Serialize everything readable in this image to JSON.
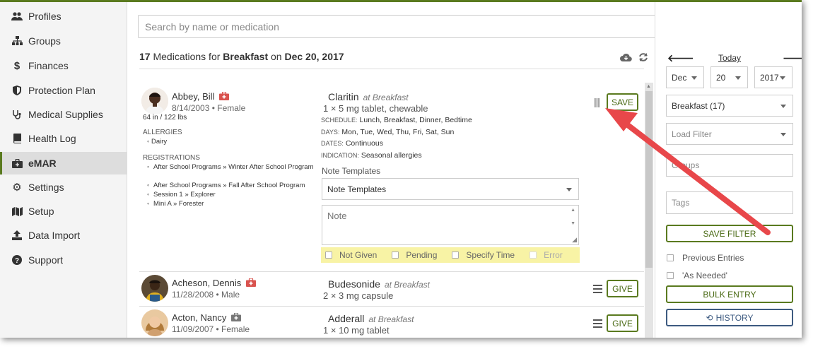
{
  "sidebar": {
    "items": [
      {
        "label": "Profiles",
        "icon": "users-icon"
      },
      {
        "label": "Groups",
        "icon": "sitemap-icon"
      },
      {
        "label": "Finances",
        "icon": "dollar-icon"
      },
      {
        "label": "Protection Plan",
        "icon": "shield-icon"
      },
      {
        "label": "Medical Supplies",
        "icon": "stethoscope-icon"
      },
      {
        "label": "Health Log",
        "icon": "book-icon"
      },
      {
        "label": "eMAR",
        "icon": "medkit-icon",
        "active": true
      },
      {
        "label": "Settings",
        "icon": "gear-icon"
      },
      {
        "label": "Setup",
        "icon": "map-icon"
      },
      {
        "label": "Data Import",
        "icon": "upload-icon"
      },
      {
        "label": "Support",
        "icon": "question-icon"
      }
    ]
  },
  "search": {
    "placeholder": "Search by name or medication"
  },
  "header": {
    "count": "17",
    "text_a": "Medications for",
    "meal": "Breakfast",
    "text_b": "on",
    "date": "Dec 20, 2017"
  },
  "rows": [
    {
      "name": "Abbey, Bill",
      "dob_gender": "8/14/2003 • Female",
      "size": "64 in / 122 lbs",
      "allergies_label": "ALLERGIES",
      "allergies": [
        "Dairy"
      ],
      "registrations_label": "REGISTRATIONS",
      "registrations": [
        "After School Programs » Winter After School Program",
        "After School Programs » Fall After School Program",
        "Session 1 » Explorer",
        "Mini A » Forester"
      ],
      "med": "Claritin",
      "at": "at Breakfast",
      "dose": "1 × 5 mg tablet, chewable",
      "schedule_k": "SCHEDULE:",
      "schedule": "Lunch, Breakfast, Dinner, Bedtime",
      "days_k": "DAYS:",
      "days": "Mon, Tue, Wed, Thu, Fri, Sat, Sun",
      "dates_k": "DATES:",
      "dates": "Continuous",
      "indication_k": "INDICATION:",
      "indication": "Seasonal allergies",
      "note_templates_label": "Note Templates",
      "note_templates_select": "Note Templates",
      "note_placeholder": "Note",
      "checks": [
        "Not Given",
        "Pending",
        "Specify Time",
        "Error"
      ],
      "button": "SAVE"
    },
    {
      "name": "Acheson, Dennis",
      "dob_gender": "11/28/2008 • Male",
      "med": "Budesonide",
      "at": "at Breakfast",
      "dose": "2 × 3 mg capsule",
      "button": "GIVE"
    },
    {
      "name": "Acton, Nancy",
      "dob_gender": "11/09/2007 • Female",
      "med": "Adderall",
      "at": "at Breakfast",
      "dose": "1 × 10 mg tablet",
      "button": "GIVE"
    }
  ],
  "right": {
    "today": "Today",
    "month": "Dec",
    "day": "20",
    "year": "2017",
    "meal_select": "Breakfast (17)",
    "load_filter": "Load Filter",
    "groups_placeholder": "Groups",
    "tags_placeholder": "Tags",
    "save_filter": "SAVE FILTER",
    "previous_entries": "Previous Entries",
    "as_needed": "'As Needed'",
    "bulk_entry": "BULK ENTRY",
    "history": "HISTORY"
  },
  "colors": {
    "accent": "#5a7a1f",
    "annotation_arrow": "#e8474a",
    "history_border": "#3d5a80"
  }
}
